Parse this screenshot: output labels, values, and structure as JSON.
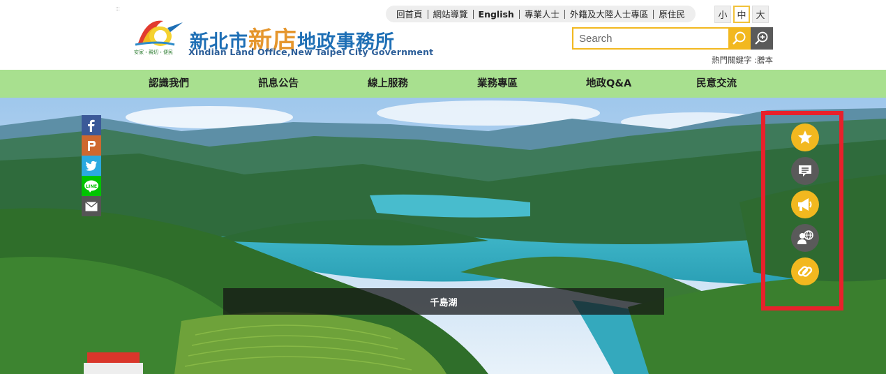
{
  "header": {
    "accesskey": ":::",
    "logo": {
      "zh_prefix": "新北市",
      "zh_accent": "新店",
      "zh_suffix": "地政事務所",
      "en": "Xindian Land Office,New Taipei City Government",
      "slogan": "安家・親切・便民"
    },
    "toplinks": [
      "回首頁",
      "網站導覽",
      "English",
      "專業人士",
      "外籍及大陸人士專區",
      "原住民"
    ],
    "fontsize": {
      "small": "小",
      "medium": "中",
      "large": "大"
    },
    "search": {
      "placeholder": "Search"
    },
    "hotkeys_label": "熱門關鍵字 :",
    "hotkeys": "謄本"
  },
  "nav": {
    "items": [
      "認識我們",
      "訊息公告",
      "線上服務",
      "業務專區",
      "地政Q&A",
      "民意交流"
    ]
  },
  "banner": {
    "caption": "千島湖"
  },
  "share": {
    "items": [
      "facebook-icon",
      "plurk-icon",
      "twitter-icon",
      "line-icon",
      "email-icon"
    ],
    "colors": {
      "facebook": "#3b5998",
      "plurk": "#cf682f",
      "twitter": "#2aa9e0",
      "line": "#00c300",
      "email": "#555555"
    }
  },
  "floatbar": {
    "highlight_color": "#e8212b",
    "items": [
      "star-icon",
      "chat-icon",
      "megaphone-icon",
      "globe-user-icon",
      "link-icon"
    ]
  },
  "colors": {
    "accent": "#f2b81f",
    "nav_bg": "#a8e08f",
    "logo_blue": "#1e6fb5"
  }
}
